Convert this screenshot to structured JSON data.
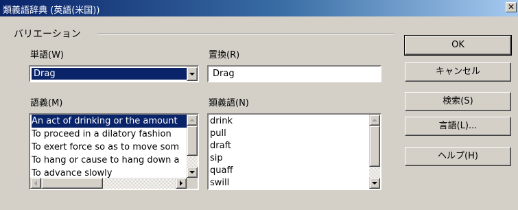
{
  "window": {
    "title": "類義語辞典 (英語(米国))",
    "close_glyph": "✕"
  },
  "group": {
    "label": "バリエーション"
  },
  "word": {
    "label": "単語(W)",
    "value": "Drag"
  },
  "replace": {
    "label": "置換(R)",
    "value": "Drag"
  },
  "meaning": {
    "label": "語義(M)",
    "items": [
      "An act of drinking or the amount",
      "To proceed in a dilatory fashion",
      "To exert force so as to move som",
      "To hang or cause to hang down a",
      "To advance slowly"
    ]
  },
  "synonym": {
    "label": "類義語(N)",
    "items": [
      "drink",
      "pull",
      "draft",
      "sip",
      "quaff",
      "swill"
    ]
  },
  "buttons": {
    "ok": "OK",
    "cancel": "キャンセル",
    "search": "検索(S)",
    "language": "言語(L)...",
    "help": "ヘルプ(H)"
  },
  "colors": {
    "selection": "#0a246a",
    "face": "#d4d0c8"
  }
}
